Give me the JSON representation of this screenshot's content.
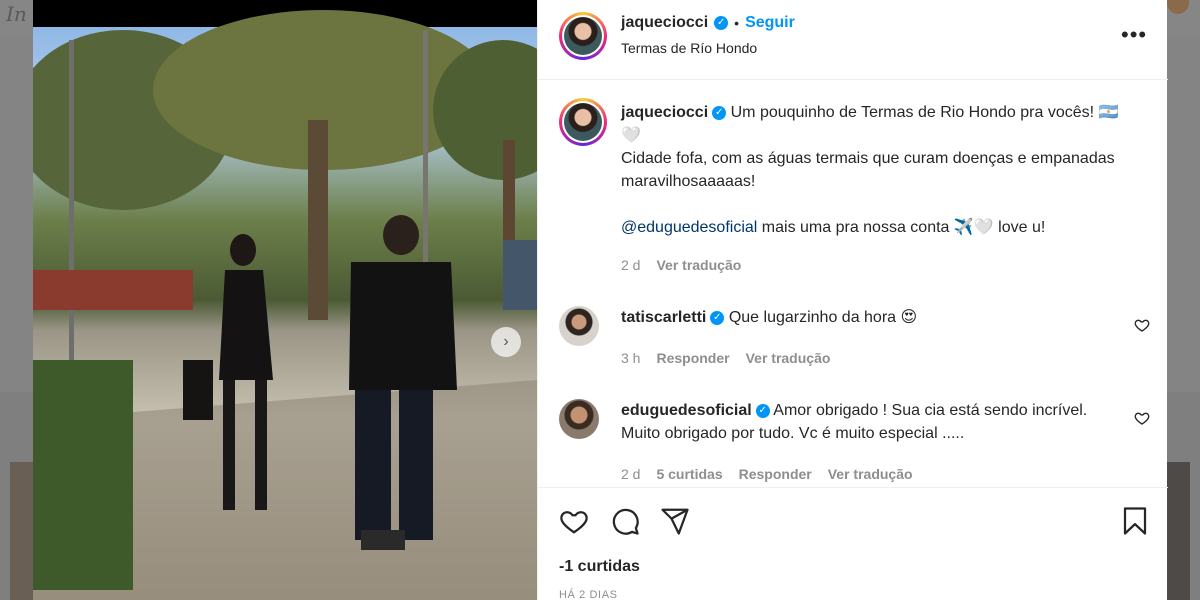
{
  "post": {
    "author": "jaqueciocci",
    "follow_label": "Seguir",
    "location": "Termas de Río Hondo",
    "caption_line1": "Um pouquinho de Termas de Rio Hondo pra vocês! 🇦🇷🤍",
    "caption_line2": "Cidade fofa, com as águas termais que curam doenças e empanadas maravilhosaaaaas!",
    "caption_mention": "@eduguedesoficial",
    "caption_line3": " mais uma pra nossa conta ✈️🤍 love u!",
    "caption_time": "2 d",
    "caption_translate": "Ver tradução",
    "likes": "-1 curtidas",
    "date": "HÁ 2 DIAS"
  },
  "comments": [
    {
      "author": "tatiscarletti",
      "text": "Que lugarzinho da hora 😍",
      "time": "3 h",
      "reply_label": "Responder",
      "translate_label": "Ver tradução"
    },
    {
      "author": "eduguedesoficial",
      "text": "Amor obrigado ! Sua cia está sendo incrível. Muito obrigado por tudo. Vc é muito especial .....",
      "time": "2 d",
      "likes_label": "5 curtidas",
      "reply_label": "Responder",
      "translate_label": "Ver tradução"
    }
  ],
  "icons": {
    "verified": "verified-badge-icon",
    "more": "more-options-icon",
    "like": "heart-icon",
    "comment": "comment-icon",
    "share": "share-icon",
    "save": "bookmark-icon",
    "next": "chevron-right-icon"
  },
  "colors": {
    "link_blue": "#0095f6",
    "mention": "#00376b",
    "muted": "#8e8e8e"
  },
  "glyphs": {
    "verified_mark": "✓",
    "dot": "•",
    "more": "•••",
    "next": "›"
  }
}
